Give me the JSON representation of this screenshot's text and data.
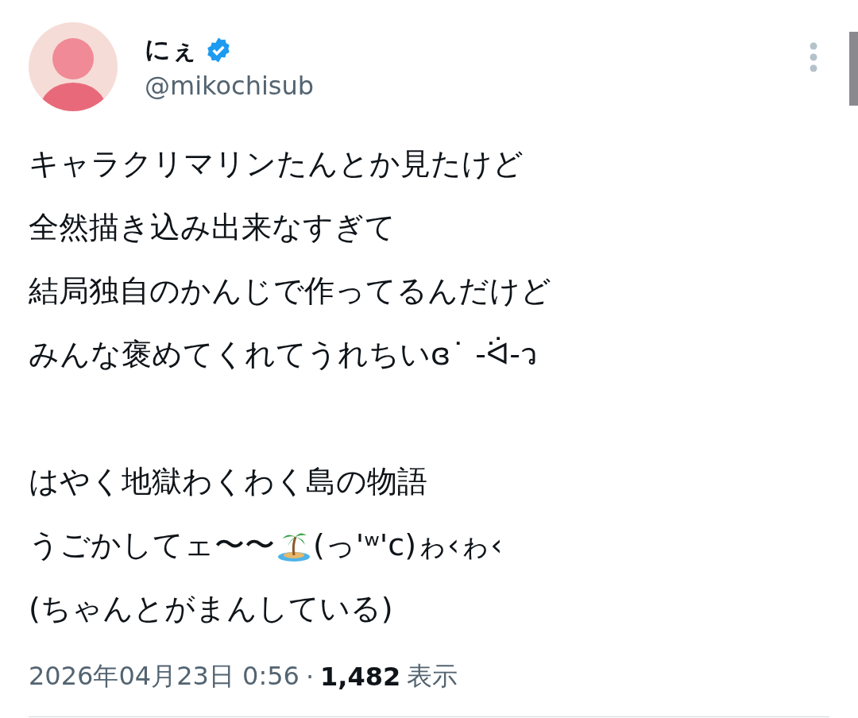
{
  "author": {
    "name": "にぇ",
    "verified": true,
    "handle": "@mikochisub"
  },
  "body": [
    [
      [
        {
          "kind": "text",
          "text": "キャラクリマリンたんとか見たけど"
        }
      ],
      [
        {
          "kind": "text",
          "text": "全然描き込み出来なすぎて"
        }
      ],
      [
        {
          "kind": "text",
          "text": "結局独自のかんじで作ってるんだけど"
        }
      ],
      [
        {
          "kind": "text",
          "text": "みんな褒めてくれてうれちいɞ˙ -ᐛ-ว"
        }
      ]
    ],
    [
      [
        {
          "kind": "text",
          "text": "はやく地獄わくわく島の物語"
        }
      ],
      [
        {
          "kind": "text",
          "text": "うごかしてェ〜〜"
        },
        {
          "kind": "emoji"
        },
        {
          "kind": "text",
          "text": "(っ'ʷ'c)ゎ‹ゎ‹"
        }
      ],
      [
        {
          "kind": "text",
          "text": "(ちゃんとがまんしている)"
        }
      ]
    ]
  ],
  "meta": {
    "timestamp": "2026年04月23日 0:56",
    "separator": "·",
    "views": "1,482",
    "views_label": "表示"
  }
}
